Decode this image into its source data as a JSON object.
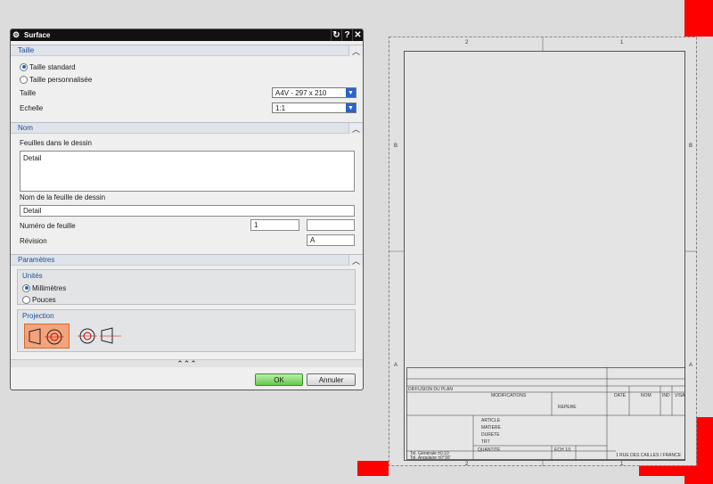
{
  "dialog": {
    "title": "Surface",
    "title_buttons": [
      "↻",
      "?",
      "✕"
    ],
    "sections": {
      "taille": {
        "header": "Taille",
        "radio_standard": "Taille standard",
        "radio_custom": "Taille personnalisée",
        "size_label": "Taille",
        "size_value": "A4V - 297 x 210",
        "scale_label": "Echelle",
        "scale_value": "1:1"
      },
      "nom": {
        "header": "Nom",
        "sheets_label": "Feuilles dans le dessin",
        "sheets_items": [
          "Detail"
        ],
        "sheet_name_label": "Nom de la feuille de dessin",
        "sheet_name_value": "Detail",
        "sheet_number_label": "Numéro de feuille",
        "sheet_number_value": "1",
        "sheet_number_extra": "",
        "revision_label": "Révision",
        "revision_value": "A"
      },
      "parametres": {
        "header": "Paramètres",
        "units_title": "Unités",
        "units_mm": "Millimètres",
        "units_in": "Pouces",
        "projection_title": "Projection"
      }
    },
    "ok_label": "OK",
    "cancel_label": "Annuler",
    "more_label": "⌃⌃⌃"
  },
  "sheet": {
    "zones_top": [
      "2",
      "1"
    ],
    "zones_bottom": [
      "2",
      "1"
    ],
    "zones_side": [
      "B",
      "A"
    ],
    "title_block": {
      "diffusion": "DIFFUSION DU PLAN",
      "modifications": "MODIFICATIONS",
      "date": "DATE",
      "nom": "NOM",
      "indice": "IND",
      "visa": "VISA",
      "repere": "REPERE",
      "article": "ARTICLE",
      "matiere": "MATIERE",
      "durete": "DURETE",
      "traitement": "TRT",
      "quantite": "QUANTITE",
      "ech": "ECH 1/1",
      "tol_generale": "Tol. Générale ±0.10",
      "tol_angulaire": "Tol. Angulaire ±0°30'",
      "company": "1 RUE DES CAILLES / FRANCE"
    }
  },
  "colors": {
    "accent_red": "#ff0000",
    "title_bar": "#111111",
    "section_blue": "#1a4fa0",
    "radio_blue": "#1f66d8",
    "ok_green": "#64c94a",
    "projection_orange": "#f4a37a"
  }
}
